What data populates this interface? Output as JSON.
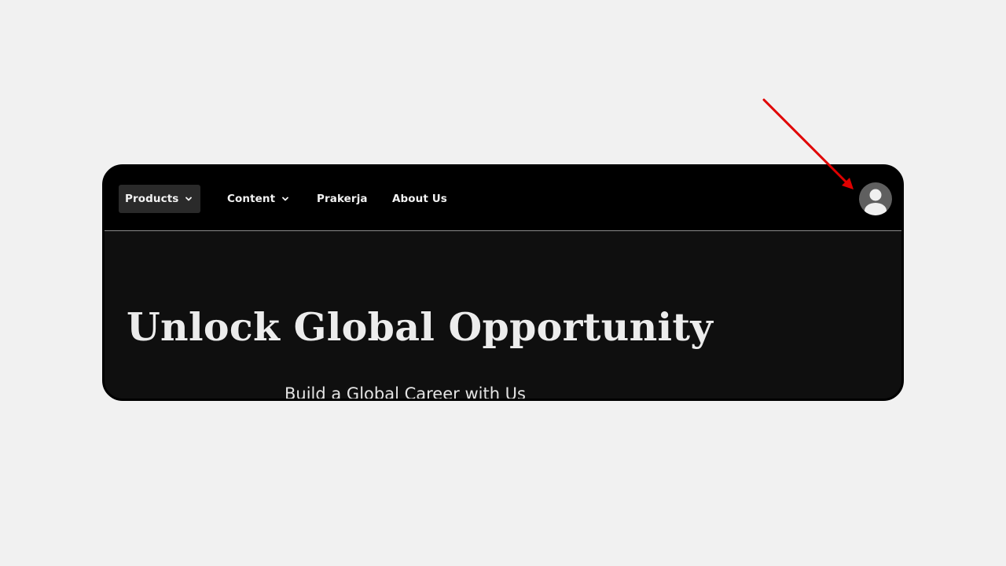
{
  "navbar": {
    "items": [
      {
        "label": "Products",
        "has_dropdown": true,
        "active": true,
        "icon": "chevron-down-icon"
      },
      {
        "label": "Content",
        "has_dropdown": true,
        "active": false,
        "icon": "chevron-down-icon"
      },
      {
        "label": "Prakerja",
        "has_dropdown": false,
        "active": false
      },
      {
        "label": "About Us",
        "has_dropdown": false,
        "active": false
      }
    ],
    "account_icon": "user-avatar-icon"
  },
  "hero": {
    "title": "Unlock Global Opportunity",
    "subtitle": "Build a Global Career with Us"
  },
  "annotation": {
    "icon": "arrow-icon",
    "color": "#e00000"
  },
  "colors": {
    "page_background": "#f1f1f1",
    "navbar_background": "#000000",
    "hero_background": "#0f0f0f",
    "active_item_background": "#2a2a2a",
    "text": "#f2f2f2",
    "avatar": "#5f5f5f"
  }
}
